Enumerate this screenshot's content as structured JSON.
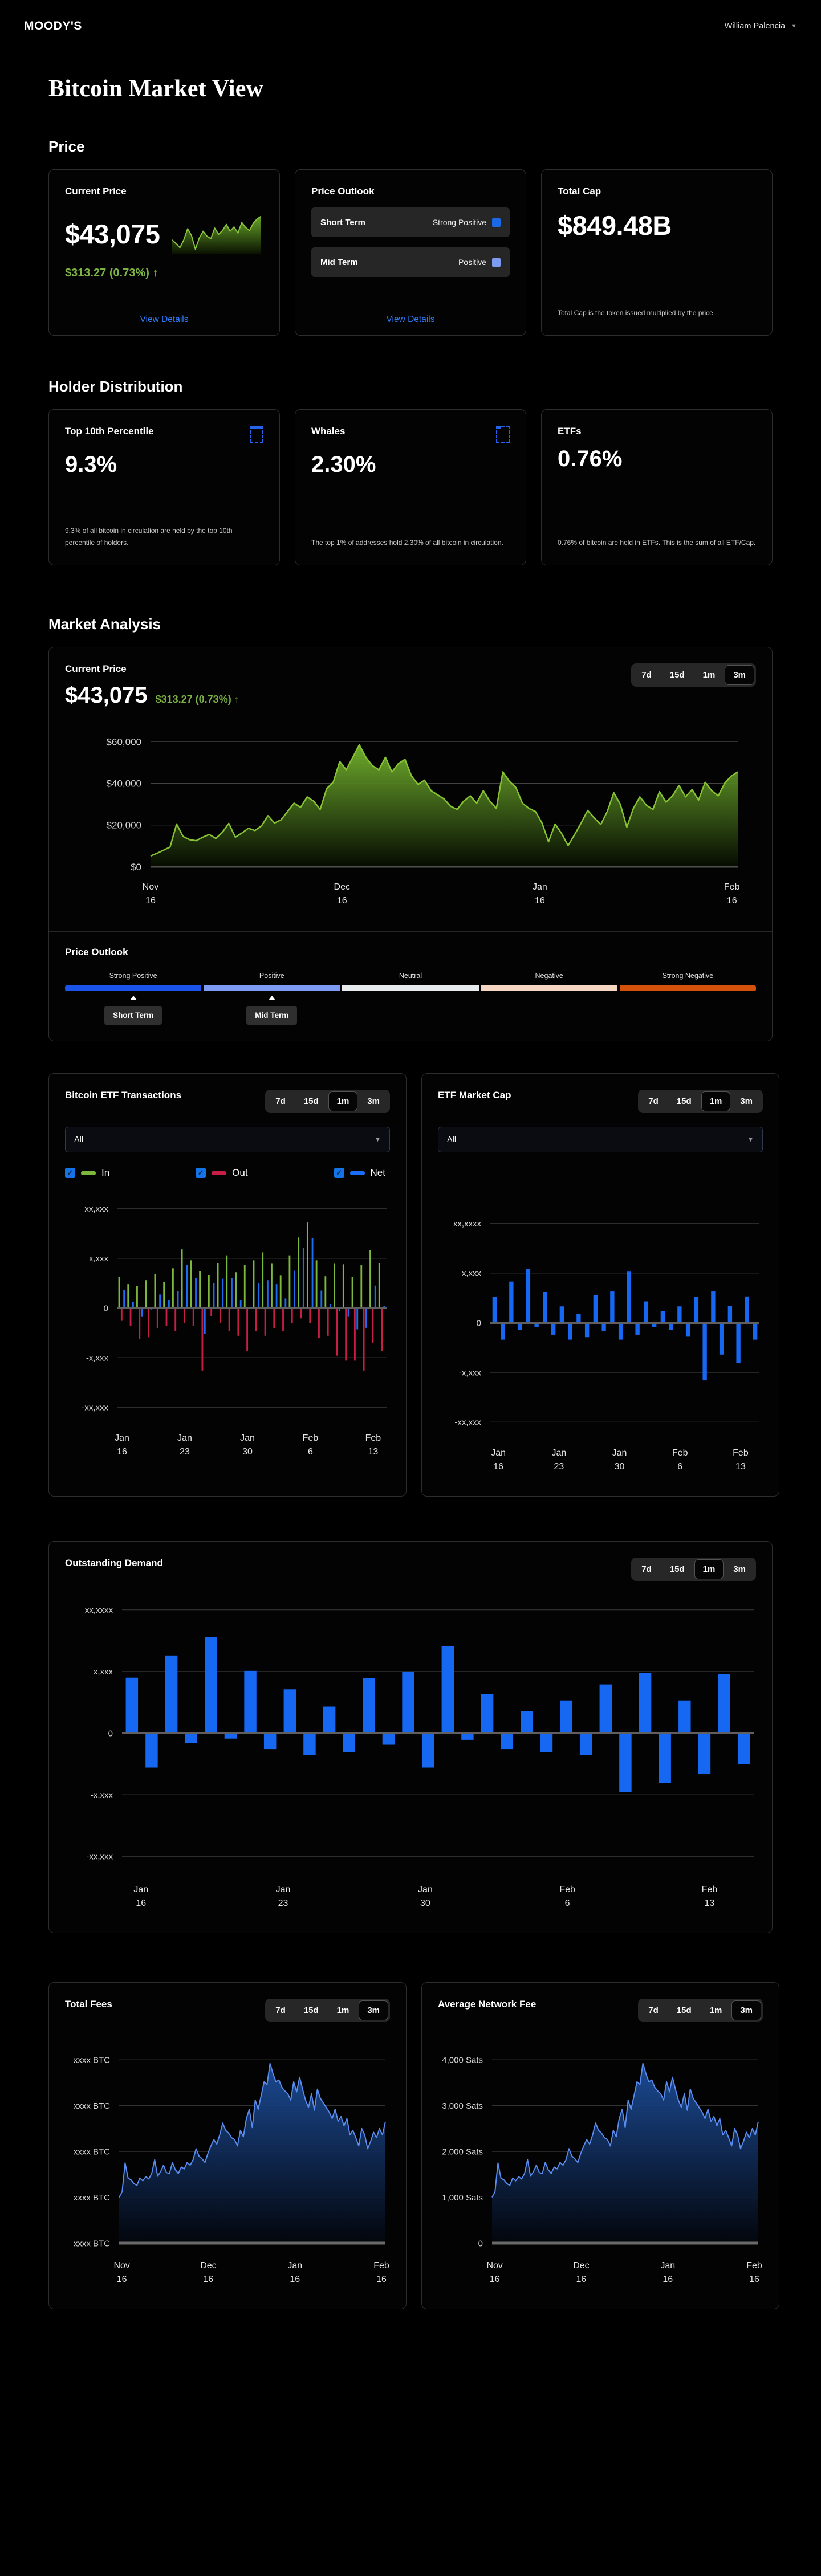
{
  "header": {
    "brand": "MOODY'S",
    "user": "William Palencia"
  },
  "page_title": "Bitcoin Market View",
  "sections": {
    "price": "Price",
    "holders": "Holder Distribution",
    "market": "Market Analysis"
  },
  "tabs": [
    "7d",
    "15d",
    "1m",
    "3m"
  ],
  "price_cards": {
    "current": {
      "title": "Current Price",
      "value": "$43,075",
      "change": "$313.27 (0.73%)",
      "arrow": "↑",
      "link": "View Details"
    },
    "outlook": {
      "title": "Price Outlook",
      "rows": [
        {
          "label": "Short Term",
          "value": "Strong Positive",
          "color": "#1a6ae8"
        },
        {
          "label": "Mid Term",
          "value": "Positive",
          "color": "#7b9cf0"
        }
      ],
      "link": "View Details"
    },
    "cap": {
      "title": "Total Cap",
      "value": "$849.48B",
      "note": "Total Cap is the token issued multiplied by the price."
    }
  },
  "holder_cards": [
    {
      "title": "Top 10th Percentile",
      "value": "9.3%",
      "note": "9.3% of all bitcoin in circulation are held by the top 10th percentile of holders."
    },
    {
      "title": "Whales",
      "value": "2.30%",
      "note": "The top 1% of addresses hold 2.30% of all bitcoin in circulation."
    },
    {
      "title": "ETFs",
      "value": "0.76%",
      "note": "0.76% of bitcoin are held in ETFs. This is the sum of all ETF/Cap."
    }
  ],
  "market_analysis": {
    "title": "Current Price",
    "value": "$43,075",
    "change": "$313.27 (0.73%)",
    "arrow": "↑",
    "outlook_title": "Price Outlook",
    "segments": [
      {
        "label": "Strong Positive",
        "color": "#1b54ea"
      },
      {
        "label": "Positive",
        "color": "#7d9bf3"
      },
      {
        "label": "Neutral",
        "color": "#e8ebee"
      },
      {
        "label": "Negative",
        "color": "#f5d6c2"
      },
      {
        "label": "Strong Negative",
        "color": "#d4510c"
      }
    ],
    "markers": [
      {
        "label": "Short Term"
      },
      {
        "label": "Mid Term"
      }
    ]
  },
  "etf_tx_card": {
    "title": "Bitcoin ETF Transactions",
    "filter": "All",
    "legend": [
      {
        "label": "In",
        "color": "#7db83c"
      },
      {
        "label": "Out",
        "color": "#c81e45"
      },
      {
        "label": "Net",
        "color": "#1a6df5"
      }
    ]
  },
  "etf_mcap_card": {
    "title": "ETF Market Cap",
    "filter": "All"
  },
  "outstanding_card": {
    "title": "Outstanding Demand"
  },
  "fees_card": {
    "title": "Total Fees"
  },
  "avg_fee_card": {
    "title": "Average Network Fee"
  },
  "chart_data": {
    "price": {
      "type": "area",
      "m": [
        14,
        34,
        78,
        150
      ],
      "ylim": [
        0,
        65000
      ],
      "stroke": "#86c232",
      "sw": 2.5,
      "fill": [
        "#76b82f",
        "#060c01"
      ],
      "bl_c": "#4f4f4f",
      "bl_w": 3,
      "yfs": 17,
      "grid": "#424242",
      "y_ticks": [
        {
          "v": 60000,
          "l": "$60,000"
        },
        {
          "v": 40000,
          "l": "$40,000"
        },
        {
          "v": 20000,
          "l": "$20,000"
        },
        {
          "v": 0,
          "l": "$0",
          "nogrid": true
        }
      ],
      "x_ticks": [
        {
          "f": 0,
          "l": [
            "Nov",
            "16"
          ]
        },
        {
          "f": 0.326,
          "l": [
            "Dec",
            "16"
          ]
        },
        {
          "f": 0.663,
          "l": [
            "Jan",
            "16"
          ]
        },
        {
          "f": 0.99,
          "l": [
            "Feb",
            "16"
          ]
        }
      ],
      "values": [
        5200,
        6500,
        8000,
        9500,
        20500,
        14500,
        13000,
        12500,
        14200,
        15500,
        13600,
        16500,
        20800,
        14200,
        16200,
        18500,
        17400,
        19600,
        24500,
        21000,
        22500,
        26500,
        30500,
        28500,
        33500,
        31500,
        27500,
        37500,
        40500,
        50500,
        46500,
        52500,
        58500,
        52500,
        48500,
        46500,
        52500,
        45500,
        49500,
        51500,
        43500,
        39500,
        41500,
        36500,
        34500,
        32500,
        29000,
        27500,
        31500,
        34000,
        30500,
        36500,
        31500,
        28000,
        45500,
        41000,
        38000,
        30500,
        28000,
        26500,
        21000,
        12000,
        20500,
        16000,
        10200,
        15500,
        21000,
        27000,
        23500,
        20300,
        26500,
        35500,
        30000,
        19000,
        28000,
        33500,
        29500,
        27500,
        36000,
        31000,
        34000,
        39000,
        33500,
        37000,
        32000,
        40500,
        36500,
        34000,
        40000,
        43500,
        45500
      ]
    },
    "sparkline": {
      "type": "area",
      "m": [
        6,
        2,
        6,
        2
      ],
      "ylim": [
        15000,
        48000
      ],
      "stroke": "#8bc53f",
      "sw": 2,
      "fill": [
        "#6fb02c",
        "#0a1200"
      ],
      "baseline": false,
      "values": [
        26500,
        23500,
        20300,
        26500,
        35500,
        30000,
        19000,
        28000,
        33500,
        29500,
        27500,
        36000,
        31000,
        34000,
        39000,
        33500,
        37000,
        32000,
        40500,
        36500,
        34000,
        40000,
        43500,
        45500
      ]
    },
    "etf_tx": {
      "type": "bars",
      "m": [
        16,
        6,
        88,
        92
      ],
      "ylim": [
        -2100,
        2100
      ],
      "y_ticks": [
        {
          "v": 2000,
          "l": "xx,xxx"
        },
        {
          "v": 1000,
          "l": "x,xxx"
        },
        {
          "v": 0,
          "l": "0",
          "nogrid": true
        },
        {
          "v": -1000,
          "l": "-x,xxx"
        },
        {
          "v": -2000,
          "l": "-xx,xxx"
        }
      ],
      "x_ticks": [
        {
          "f": 0.017,
          "l": [
            "Jan",
            "16"
          ]
        },
        {
          "f": 0.25,
          "l": [
            "Jan",
            "23"
          ]
        },
        {
          "f": 0.483,
          "l": [
            "Jan",
            "30"
          ]
        },
        {
          "f": 0.717,
          "l": [
            "Feb",
            "6"
          ]
        },
        {
          "f": 0.95,
          "l": [
            "Feb",
            "13"
          ]
        }
      ],
      "series": [
        {
          "name": "In",
          "color": "#7db83c",
          "values": [
            620,
            480,
            440,
            560,
            680,
            520,
            800,
            1180,
            960,
            740,
            660,
            900,
            1060,
            720,
            870,
            960,
            1120,
            890,
            650,
            1060,
            1420,
            1720,
            960,
            640,
            890,
            880,
            630,
            860,
            1160,
            900
          ]
        },
        {
          "name": "Out",
          "color": "#c81e45",
          "values": [
            -260,
            -360,
            -620,
            -590,
            -410,
            -360,
            -460,
            -310,
            -360,
            -1260,
            -160,
            -310,
            -460,
            -560,
            -860,
            -460,
            -560,
            -410,
            -460,
            -310,
            -210,
            -310,
            -610,
            -560,
            -960,
            -1060,
            -1060,
            -1260,
            -710,
            -860
          ]
        },
        {
          "name": "Net",
          "color": "#1a6df5",
          "values": [
            360,
            120,
            -180,
            -30,
            270,
            160,
            340,
            870,
            600,
            -520,
            500,
            590,
            600,
            160,
            10,
            500,
            560,
            480,
            190,
            750,
            1210,
            1410,
            350,
            80,
            -70,
            -180,
            -430,
            -400,
            450,
            40
          ]
        }
      ]
    },
    "etf_mcap": {
      "type": "bars",
      "m": [
        16,
        6,
        88,
        92
      ],
      "ylim": [
        -2100,
        2100
      ],
      "color": "#1667f2",
      "bwf": 0.5,
      "y_ticks": [
        {
          "v": 2000,
          "l": "xx,xxxx"
        },
        {
          "v": 1000,
          "l": "x,xxx"
        },
        {
          "v": 0,
          "l": "0",
          "nogrid": true
        },
        {
          "v": -1000,
          "l": "-x,xxx"
        },
        {
          "v": -2000,
          "l": "-xx,xxx"
        }
      ],
      "x_ticks": [
        {
          "f": 0.03,
          "l": [
            "Jan",
            "16"
          ]
        },
        {
          "f": 0.255,
          "l": [
            "Jan",
            "23"
          ]
        },
        {
          "f": 0.48,
          "l": [
            "Jan",
            "30"
          ]
        },
        {
          "f": 0.705,
          "l": [
            "Feb",
            "6"
          ]
        },
        {
          "f": 0.93,
          "l": [
            "Feb",
            "13"
          ]
        }
      ],
      "values": [
        520,
        -340,
        830,
        -140,
        1090,
        -90,
        620,
        -240,
        330,
        -340,
        180,
        -290,
        560,
        -160,
        630,
        -340,
        1030,
        -240,
        430,
        -90,
        230,
        -140,
        330,
        -280,
        520,
        -1160,
        630,
        -640,
        340,
        -810,
        530,
        -340
      ]
    },
    "outstanding": {
      "type": "bars",
      "m": [
        16,
        10,
        90,
        100
      ],
      "ylim": [
        -2100,
        2100
      ],
      "color": "#1667f2",
      "bwf": 0.62,
      "y_ticks": [
        {
          "v": 2000,
          "l": "xx,xxxx"
        },
        {
          "v": 1000,
          "l": "x,xxx"
        },
        {
          "v": 0,
          "l": "0",
          "nogrid": true
        },
        {
          "v": -1000,
          "l": "-x,xxx"
        },
        {
          "v": -2000,
          "l": "-xx,xxx"
        }
      ],
      "x_ticks": [
        {
          "f": 0.03,
          "l": [
            "Jan",
            "16"
          ]
        },
        {
          "f": 0.255,
          "l": [
            "Jan",
            "23"
          ]
        },
        {
          "f": 0.48,
          "l": [
            "Jan",
            "30"
          ]
        },
        {
          "f": 0.705,
          "l": [
            "Feb",
            "6"
          ]
        },
        {
          "f": 0.93,
          "l": [
            "Feb",
            "13"
          ]
        }
      ],
      "values": [
        900,
        -560,
        1260,
        -160,
        1560,
        -90,
        1010,
        -260,
        710,
        -360,
        430,
        -310,
        890,
        -190,
        1000,
        -560,
        1410,
        -110,
        630,
        -260,
        360,
        -310,
        530,
        -360,
        790,
        -960,
        980,
        -810,
        530,
        -660,
        960,
        -500
      ]
    },
    "total_fees": {
      "type": "area",
      "m": [
        14,
        8,
        82,
        95
      ],
      "ylim": [
        0,
        4400
      ],
      "stroke": "#5a8cf0",
      "sw": 2,
      "fill": [
        "#1d4f9e",
        "#03060d"
      ],
      "bl_c": "#6a6a6a",
      "bl_w": 5,
      "values_from": "avg_fee",
      "y_ticks": [
        {
          "v": 4000,
          "l": "xxxx BTC"
        },
        {
          "v": 3000,
          "l": "xxxx BTC"
        },
        {
          "v": 2000,
          "l": "xxxx BTC"
        },
        {
          "v": 1000,
          "l": "xxxx BTC"
        },
        {
          "v": 0,
          "l": "xxxx BTC",
          "nogrid": true
        }
      ],
      "x_ticks": [
        {
          "f": 0.01,
          "l": [
            "Nov",
            "16"
          ]
        },
        {
          "f": 0.335,
          "l": [
            "Dec",
            "16"
          ]
        },
        {
          "f": 0.66,
          "l": [
            "Jan",
            "16"
          ]
        },
        {
          "f": 0.985,
          "l": [
            "Feb",
            "16"
          ]
        }
      ]
    },
    "avg_fee": {
      "type": "area",
      "m": [
        14,
        8,
        82,
        95
      ],
      "ylim": [
        0,
        4400
      ],
      "stroke": "#5a8cf0",
      "sw": 2,
      "fill": [
        "#1d4f9e",
        "#03060d"
      ],
      "bl_c": "#6a6a6a",
      "bl_w": 5,
      "y_ticks": [
        {
          "v": 4000,
          "l": "4,000 Sats"
        },
        {
          "v": 3000,
          "l": "3,000 Sats"
        },
        {
          "v": 2000,
          "l": "2,000 Sats"
        },
        {
          "v": 1000,
          "l": "1,000 Sats"
        },
        {
          "v": 0,
          "l": "0",
          "nogrid": true
        }
      ],
      "x_ticks": [
        {
          "f": 0.01,
          "l": [
            "Nov",
            "16"
          ]
        },
        {
          "f": 0.335,
          "l": [
            "Dec",
            "16"
          ]
        },
        {
          "f": 0.66,
          "l": [
            "Jan",
            "16"
          ]
        },
        {
          "f": 0.985,
          "l": [
            "Feb",
            "16"
          ]
        }
      ],
      "values": [
        1000,
        1120,
        1750,
        1420,
        1380,
        1300,
        1260,
        1420,
        1360,
        1450,
        1400,
        1520,
        1820,
        1460,
        1560,
        1700,
        1540,
        1520,
        1760,
        1600,
        1520,
        1660,
        1620,
        1760,
        1700,
        1820,
        2060,
        1900,
        1840,
        1760,
        1960,
        2120,
        2260,
        2160,
        2360,
        2620,
        2460,
        2400,
        2300,
        2260,
        2120,
        2460,
        2320,
        2720,
        2920,
        2520,
        3120,
        2920,
        3220,
        3520,
        3460,
        3920,
        3700,
        3520,
        3560,
        3400,
        3320,
        3260,
        3120,
        3520,
        3300,
        3620,
        3360,
        3120,
        2960,
        3260,
        2900,
        3360,
        3160,
        3060,
        2960,
        2860,
        2720,
        2920,
        2660,
        2760,
        2560,
        2720,
        2360,
        2460,
        2300,
        2120,
        2500,
        2360,
        2060,
        2220,
        2420,
        2300,
        2500,
        2360,
        2650
      ]
    }
  }
}
